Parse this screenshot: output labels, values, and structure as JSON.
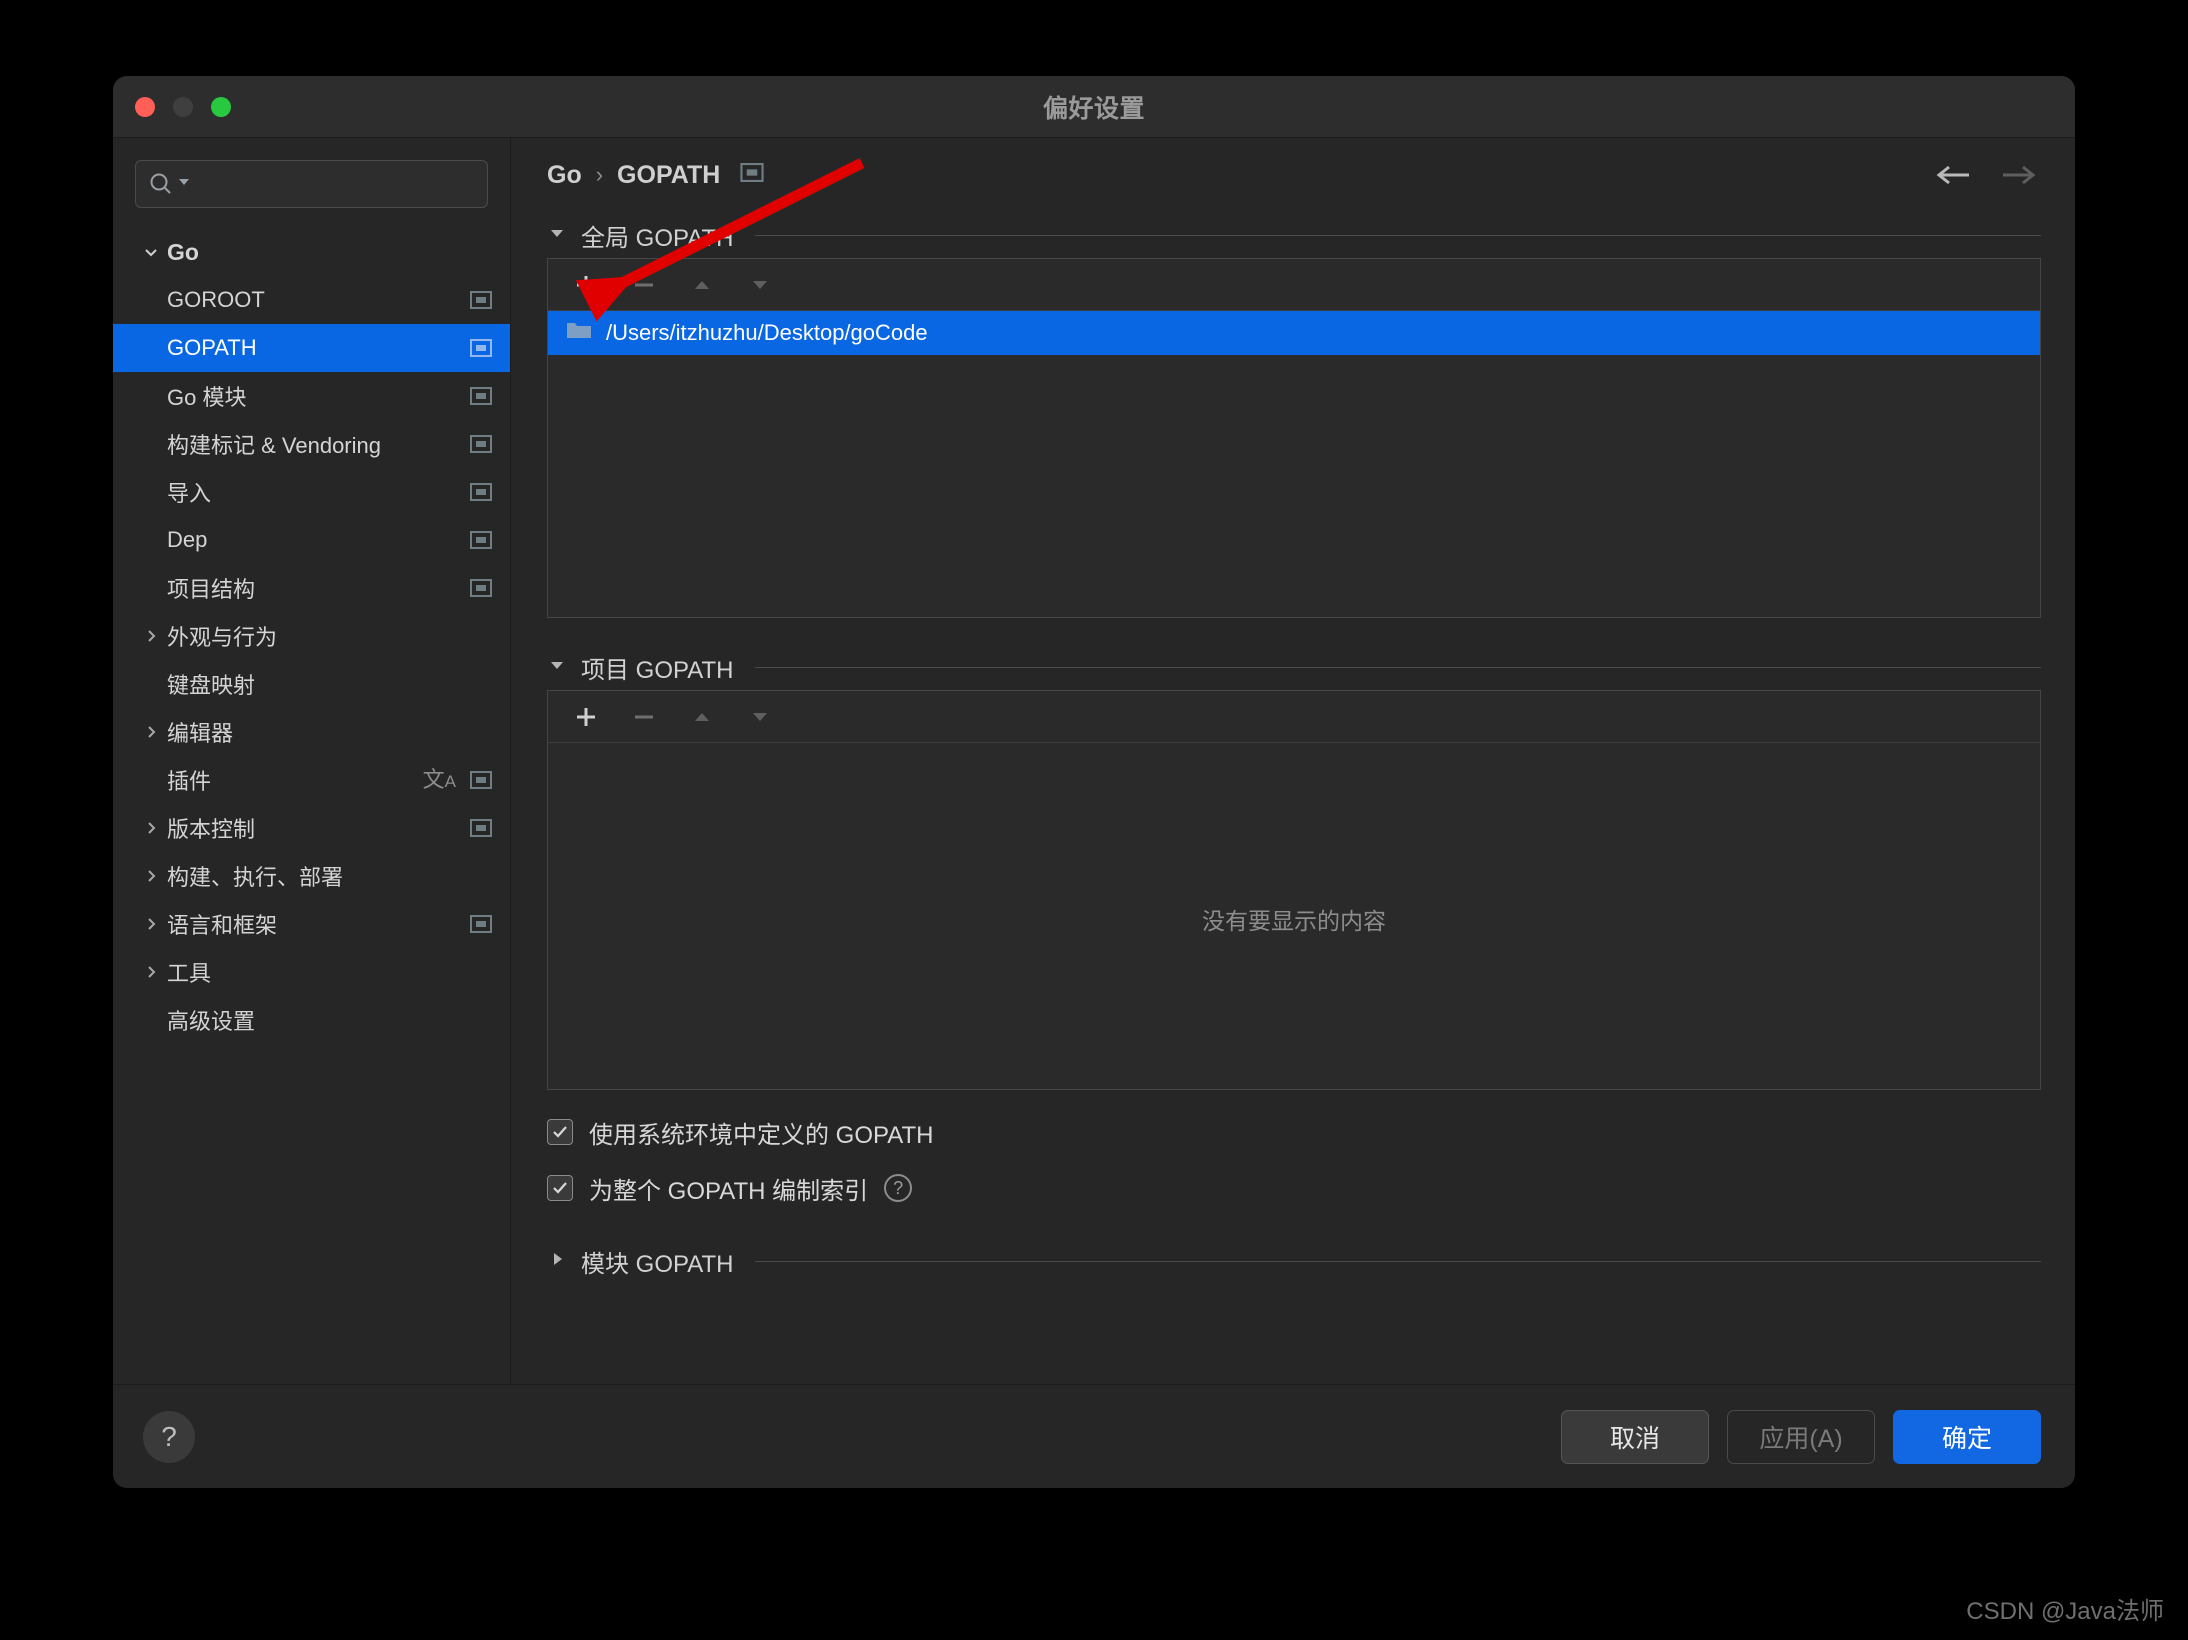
{
  "window": {
    "title": "偏好设置",
    "traffic_lights": [
      "close-red",
      "minimize-disabled",
      "zoom-green"
    ]
  },
  "sidebar": {
    "search": {
      "value": "",
      "placeholder": "",
      "icon": "search-icon",
      "dropdown_icon": "chevron-down-icon"
    },
    "items": [
      {
        "label": "Go",
        "level": 0,
        "expanded": true,
        "arrow": "chevron-down-icon",
        "scope_badge": false,
        "selected": false
      },
      {
        "label": "GOROOT",
        "level": 2,
        "arrow": null,
        "scope_badge": true,
        "selected": false
      },
      {
        "label": "GOPATH",
        "level": 2,
        "arrow": null,
        "scope_badge": true,
        "selected": true
      },
      {
        "label": "Go 模块",
        "level": 2,
        "arrow": null,
        "scope_badge": true,
        "selected": false
      },
      {
        "label": "构建标记 & Vendoring",
        "level": 2,
        "arrow": null,
        "scope_badge": true,
        "selected": false
      },
      {
        "label": "导入",
        "level": 2,
        "arrow": null,
        "scope_badge": true,
        "selected": false
      },
      {
        "label": "Dep",
        "level": 2,
        "arrow": null,
        "scope_badge": true,
        "selected": false
      },
      {
        "label": "项目结构",
        "level": 1,
        "arrow": null,
        "scope_badge": true,
        "selected": false
      },
      {
        "label": "外观与行为",
        "level": 1,
        "arrow": "chevron-right-icon",
        "scope_badge": false,
        "selected": false
      },
      {
        "label": "键盘映射",
        "level": 1,
        "arrow": null,
        "scope_badge": false,
        "selected": false
      },
      {
        "label": "编辑器",
        "level": 1,
        "arrow": "chevron-right-icon",
        "scope_badge": false,
        "selected": false
      },
      {
        "label": "插件",
        "level": 1,
        "arrow": null,
        "scope_badge": true,
        "translate_badge": true,
        "selected": false
      },
      {
        "label": "版本控制",
        "level": 1,
        "arrow": "chevron-right-icon",
        "scope_badge": true,
        "selected": false
      },
      {
        "label": "构建、执行、部署",
        "level": 1,
        "arrow": "chevron-right-icon",
        "scope_badge": false,
        "selected": false
      },
      {
        "label": "语言和框架",
        "level": 1,
        "arrow": "chevron-right-icon",
        "scope_badge": true,
        "selected": false
      },
      {
        "label": "工具",
        "level": 1,
        "arrow": "chevron-right-icon",
        "scope_badge": false,
        "selected": false
      },
      {
        "label": "高级设置",
        "level": 1,
        "arrow": null,
        "scope_badge": false,
        "selected": false
      }
    ]
  },
  "breadcrumb": {
    "root": "Go",
    "separator": "›",
    "current": "GOPATH",
    "scope_badge": true,
    "back_icon": "arrow-left-icon",
    "forward_icon": "arrow-right-icon"
  },
  "main": {
    "global_section": {
      "title": "全局 GOPATH",
      "expanded": true,
      "collapse_icon": "triangle-down-icon",
      "toolbar": {
        "add": "+",
        "remove": "−",
        "move_up": "▲",
        "move_down": "▼",
        "add_enabled": true,
        "remove_enabled": false,
        "move_up_enabled": false,
        "move_down_enabled": false
      },
      "entries": [
        {
          "path": "/Users/itzhuzhu/Desktop/goCode",
          "icon": "folder-icon",
          "selected": true
        }
      ]
    },
    "project_section": {
      "title": "项目 GOPATH",
      "expanded": true,
      "collapse_icon": "triangle-down-icon",
      "toolbar": {
        "add": "+",
        "remove": "−",
        "move_up": "▲",
        "move_down": "▼",
        "add_enabled": true,
        "remove_enabled": false,
        "move_up_enabled": false,
        "move_down_enabled": false
      },
      "empty_text": "没有要显示的内容",
      "entries": []
    },
    "options": [
      {
        "label": "使用系统环境中定义的 GOPATH",
        "checked": true,
        "help": false
      },
      {
        "label": "为整个 GOPATH 编制索引",
        "checked": true,
        "help": true,
        "help_icon": "question-circle-icon"
      }
    ],
    "module_section": {
      "title": "模块 GOPATH",
      "expanded": false,
      "collapse_icon": "triangle-right-icon"
    }
  },
  "footer": {
    "help_label": "?",
    "cancel": "取消",
    "apply": "应用(A)",
    "ok": "确定",
    "apply_enabled": false
  },
  "annotation": {
    "type": "arrow",
    "color": "#E00000",
    "points_to": "add-global-gopath-button"
  },
  "watermark": "CSDN @Java法师",
  "colors": {
    "accent": "#1268e3",
    "selection": "#0a67e4",
    "window_bg": "#262626",
    "title_bg": "#2d2d2d",
    "panel_bg": "#2a2a2a",
    "text": "#d4d4d4",
    "muted": "#8d8d8d",
    "annotation_red": "#E00000"
  }
}
